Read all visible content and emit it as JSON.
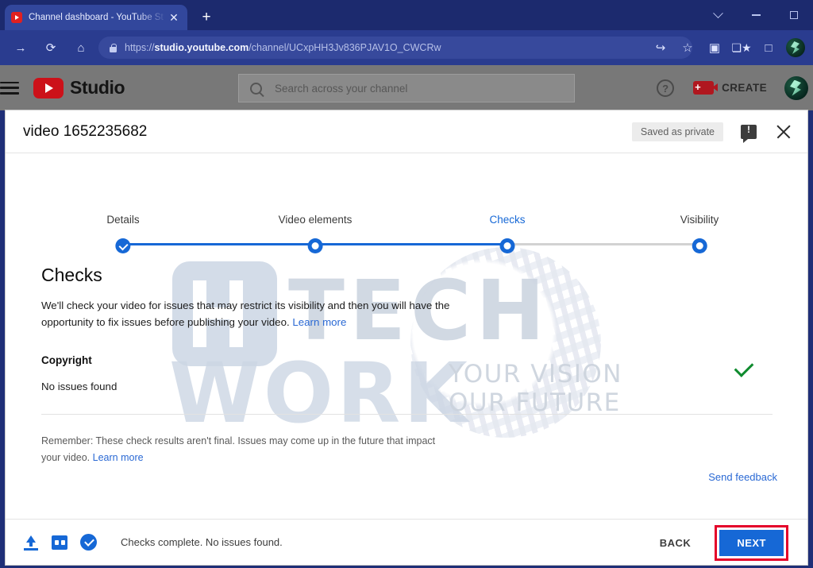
{
  "browser": {
    "tab": {
      "title": "Channel dashboard - YouTube St",
      "favicon": "youtube-favicon",
      "close": "✕"
    },
    "new_tab": "+",
    "window_controls": {
      "tab_search": "chevron-down-icon",
      "minimize": "minimize-icon",
      "maximize": "maximize-icon"
    },
    "nav": {
      "forward": "→",
      "reload": "⟳",
      "home": "⌂"
    },
    "omnibox": {
      "scheme": "https://",
      "host": "studio.youtube.com",
      "path": "/channel/UCxpHH3Jv836PJAV1O_CWCRw",
      "full_url": "https://studio.youtube.com/channel/UCxpHH3Jv836PJAV1O_CWCRw",
      "lock": "lock-icon"
    },
    "actions": {
      "share": "↪",
      "bookmark": "☆",
      "capture": "▣",
      "extensions": "puzzle-icon",
      "sidepanel": "□",
      "profile": "avatar"
    }
  },
  "studio": {
    "menu": "hamburger-icon",
    "logo_text": "Studio",
    "search": {
      "placeholder": "Search across your channel",
      "value": ""
    },
    "help": "?",
    "create_label": "CREATE"
  },
  "dialog": {
    "title": "video 1652235682",
    "saved_badge": "Saved as private",
    "feedback_icon": "feedback-icon",
    "close_icon": "close-icon",
    "steps": [
      {
        "label": "Details",
        "state": "completed"
      },
      {
        "label": "Video elements",
        "state": "completed"
      },
      {
        "label": "Checks",
        "state": "active"
      },
      {
        "label": "Visibility",
        "state": "upcoming"
      }
    ],
    "heading": "Checks",
    "description": "We'll check your video for issues that may restrict its visibility and then you will have the opportunity to fix issues before publishing your video.",
    "description_link": "Learn more",
    "copyright": {
      "title": "Copyright",
      "status": "No issues found",
      "result_icon": "green-check-icon"
    },
    "remember_text": "Remember: These check results aren't final. Issues may come up in the future that impact your video.",
    "remember_link": "Learn more",
    "send_feedback": "Send feedback",
    "footer": {
      "upload_icon": "upload-icon",
      "elements_icon": "video-elements-icon",
      "checks_icon": "checks-complete-icon",
      "status": "Checks complete. No issues found.",
      "back_label": "BACK",
      "next_label": "NEXT"
    }
  },
  "watermark": {
    "word1": "HI",
    "word2": "TECH",
    "word3": "WORK",
    "tagline_line1": "YOUR VISION",
    "tagline_line2": "OUR FUTURE"
  },
  "colors": {
    "accent_blue": "#1668d6",
    "link_blue": "#2a69d4",
    "highlight_red": "#e4022a",
    "success_green": "#0f8b2e",
    "youtube_red": "#cc1119"
  }
}
